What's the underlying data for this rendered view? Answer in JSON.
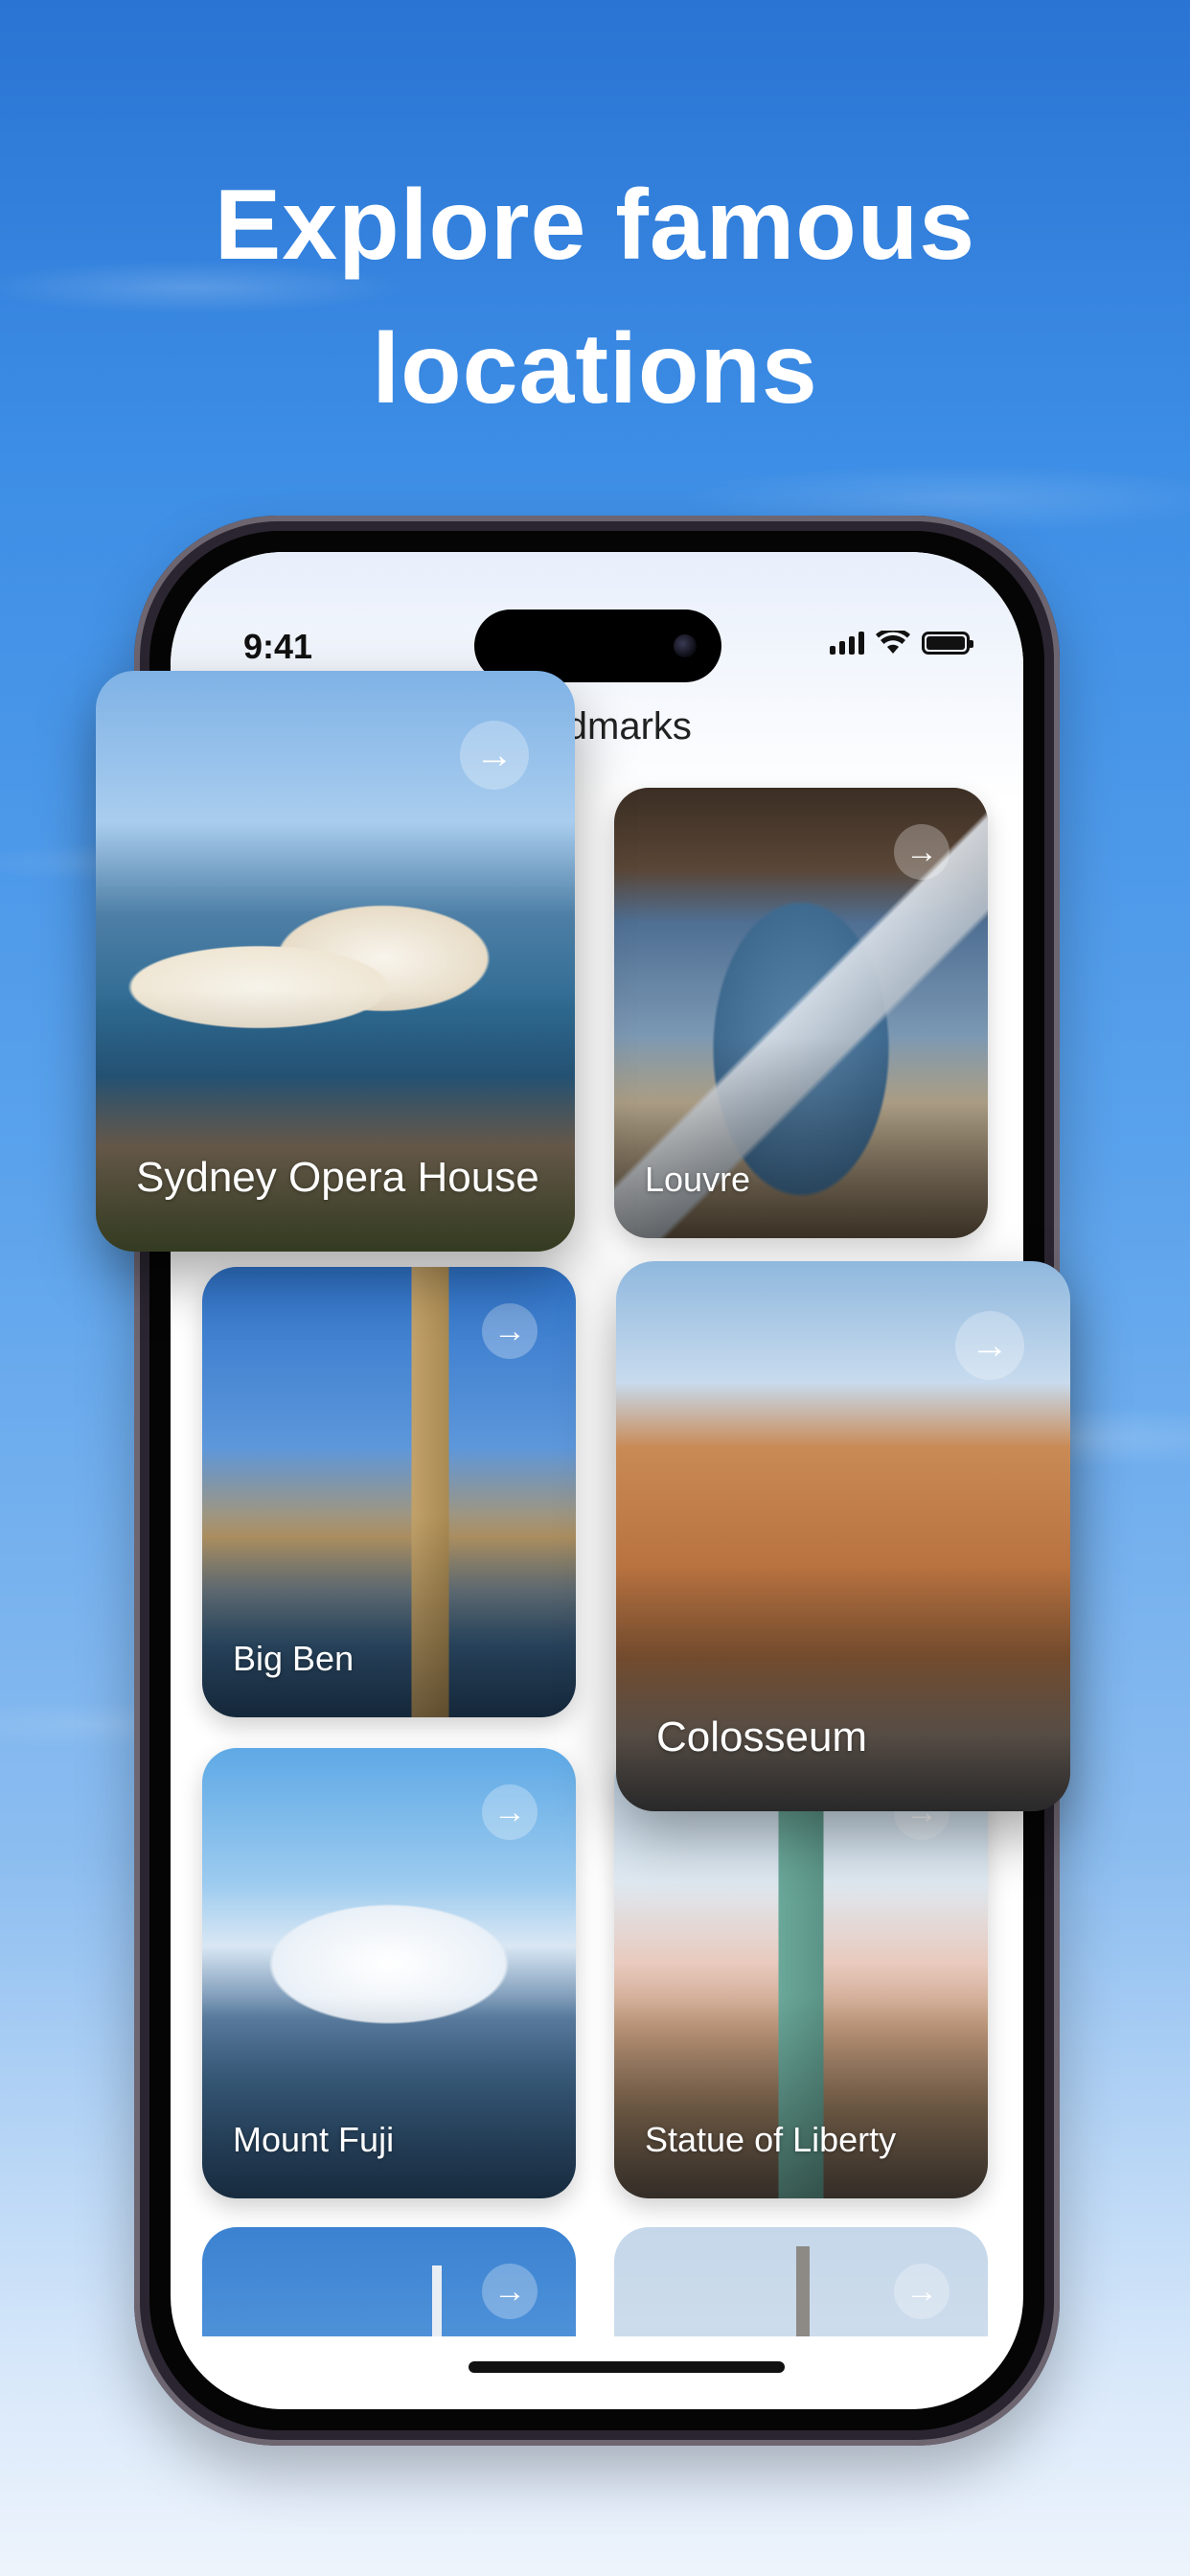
{
  "headline": {
    "line1": "Explore famous",
    "line2": "locations"
  },
  "status_bar": {
    "time": "9:41",
    "icons": [
      "cellular-signal-icon",
      "wifi-icon",
      "battery-icon"
    ]
  },
  "screen": {
    "title": "Landmarks"
  },
  "cards": [
    {
      "id": "sydney",
      "label": "Sydney Opera House",
      "action_icon": "arrow-right-icon"
    },
    {
      "id": "louvre",
      "label": "Louvre",
      "action_icon": "arrow-right-icon"
    },
    {
      "id": "bigben",
      "label": "Big Ben",
      "action_icon": "arrow-right-icon"
    },
    {
      "id": "colosseum",
      "label": "Colosseum",
      "action_icon": "arrow-right-icon"
    },
    {
      "id": "fuji",
      "label": "Mount Fuji",
      "action_icon": "arrow-right-icon"
    },
    {
      "id": "liberty",
      "label": "Statue of Liberty",
      "action_icon": "arrow-right-icon"
    },
    {
      "id": "dubai",
      "label": "",
      "action_icon": "arrow-right-icon"
    },
    {
      "id": "eiffel",
      "label": "",
      "action_icon": "arrow-right-icon"
    }
  ],
  "colors": {
    "background_top": "#2a74d3",
    "background_bottom": "#eef4fc",
    "headline_text": "#ffffff",
    "phone_frame": "#2a2530"
  }
}
